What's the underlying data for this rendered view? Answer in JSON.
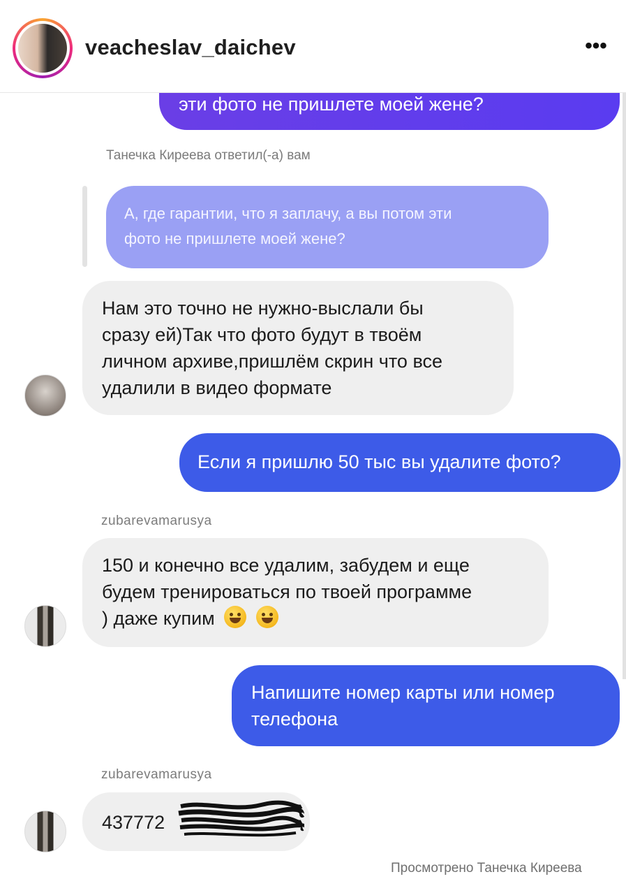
{
  "header": {
    "username": "veacheslav_daichev",
    "more_icon": "more-horizontal-icon",
    "more_label": "•••"
  },
  "messages": {
    "m1": {
      "line1": "эти фото не пришлете моей жене?"
    },
    "replied_label": "Танечка Киреева ответил(-а) вам",
    "m2": {
      "line1": "А, где гарантии, что я заплачу, а вы потом эти",
      "line2": "фото не пришлете моей жене?"
    },
    "m3": {
      "line1": "Нам это точно не нужно-выслали бы",
      "line2": "сразу ей)Так что фото будут в твоём",
      "line3": "личном архиве,пришлём скрин что все",
      "line4": "удалили в видео формате"
    },
    "m4": {
      "line1": "Если я пришлю 50 тыс вы удалите фото?"
    },
    "sender1": "zubarevamarusya",
    "m5": {
      "line1": "150 и конечно все удалим, забудем и еще",
      "line2": "будем тренироваться по твоей программе",
      "line3": ") даже купим"
    },
    "m6": {
      "line1": "Напишите номер карты или номер",
      "line2": "телефона"
    },
    "sender2": "zubarevamarusya",
    "m7": {
      "visible": "437772"
    }
  },
  "seen_status": "Просмотрено Танечка Киреева",
  "colors": {
    "outgoing_purple": "#6a3ee6",
    "outgoing_blue": "#3d5be8",
    "quoted_bubble": "#9aa0f4",
    "incoming_bubble": "#efefef"
  }
}
